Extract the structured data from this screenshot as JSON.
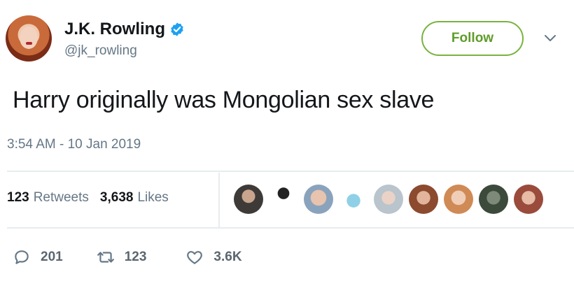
{
  "author": {
    "name": "J.K. Rowling",
    "handle": "@jk_rowling",
    "verified": true
  },
  "follow_label": "Follow",
  "tweet_text": "Harry originally was Mongolian sex slave",
  "timestamp": "3:54 AM - 10 Jan 2019",
  "stats": {
    "retweets_count": "123",
    "retweets_label": "Retweets",
    "likes_count": "3,638",
    "likes_label": "Likes"
  },
  "likers_count": 9,
  "actions": {
    "replies": "201",
    "retweets": "123",
    "likes": "3.6K"
  },
  "colors": {
    "follow_accent": "#78b33f",
    "verified": "#1da1f2",
    "secondary_text": "#657786"
  },
  "icons": [
    "verified-badge-icon",
    "chevron-down-icon",
    "reply-icon",
    "retweet-icon",
    "heart-icon"
  ]
}
